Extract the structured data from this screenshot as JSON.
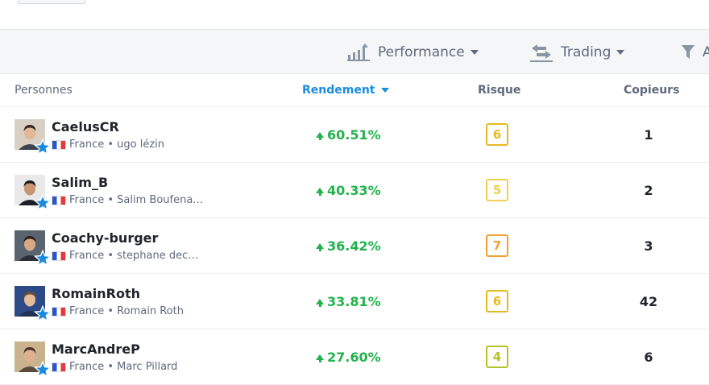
{
  "filters": {
    "performance_label": "Performance",
    "trading_label": "Trading",
    "third_label": "A"
  },
  "columns": {
    "personnes": "Personnes",
    "rendement": "Rendement",
    "risque": "Risque",
    "copieurs": "Copieurs"
  },
  "rows": [
    {
      "username": "CaelusCR",
      "country": "France",
      "fullname": "• ugo lézin",
      "gain": "60.51%",
      "risk": "6",
      "risk_color": "#e8b820",
      "copiers": "1"
    },
    {
      "username": "Salim_B",
      "country": "France",
      "fullname": "• Salim Boufena…",
      "gain": "40.33%",
      "risk": "5",
      "risk_color": "#f0cf52",
      "copiers": "2"
    },
    {
      "username": "Coachy-burger",
      "country": "France",
      "fullname": "• stephane dec…",
      "gain": "36.42%",
      "risk": "7",
      "risk_color": "#f2a031",
      "copiers": "3"
    },
    {
      "username": "RomainRoth",
      "country": "France",
      "fullname": "• Romain Roth",
      "gain": "33.81%",
      "risk": "6",
      "risk_color": "#e8b820",
      "copiers": "42"
    },
    {
      "username": "MarcAndreP",
      "country": "France",
      "fullname": "• Marc Pillard",
      "gain": "27.60%",
      "risk": "4",
      "risk_color": "#b5c22a",
      "copiers": "6"
    }
  ],
  "colors": {
    "accent": "#1a8ce0",
    "gain": "#21b24b",
    "star": "#1a8ce0"
  }
}
